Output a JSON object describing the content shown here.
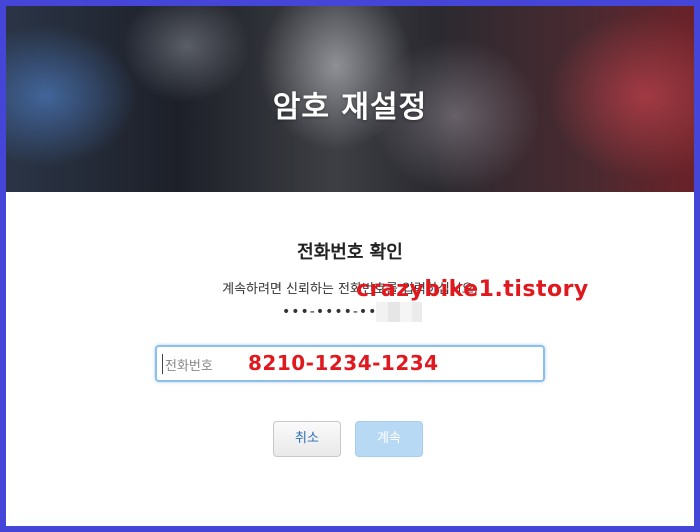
{
  "header": {
    "title": "암호 재설정"
  },
  "verify": {
    "title": "전화번호 확인",
    "instruction": "계속하려면 신뢰하는 전화번호를 입력하십시오.",
    "masked_number": "•••-••••-••"
  },
  "phone_input": {
    "placeholder": "전화번호",
    "value": ""
  },
  "overlay": {
    "watermark": "crazybike1.tistory",
    "entered_number": "8210-1234-1234"
  },
  "buttons": {
    "cancel": "취소",
    "continue": "계속"
  },
  "colors": {
    "frame": "#4545d8",
    "input_focus": "#8cc0ea",
    "continue_disabled": "#b8d9f4",
    "overlay_red": "#e0191f"
  }
}
